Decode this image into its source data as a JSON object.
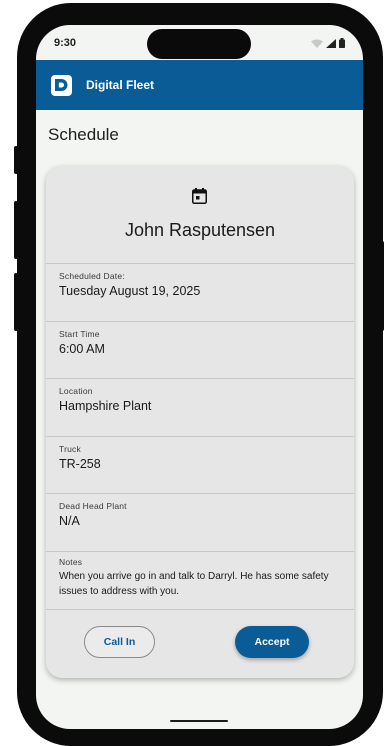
{
  "status_bar": {
    "time": "9:30",
    "icons": [
      "wifi-icon",
      "signal-icon",
      "battery-icon"
    ]
  },
  "app_bar": {
    "title": "Digital Fleet",
    "logo_letter": "D",
    "color": "#0a5c97"
  },
  "page": {
    "title": "Schedule"
  },
  "schedule": {
    "icon": "calendar-icon",
    "driver_name": "John Rasputensen",
    "fields": [
      {
        "label": "Scheduled Date:",
        "value": "Tuesday August 19, 2025"
      },
      {
        "label": "Start Time",
        "value": "6:00 AM"
      },
      {
        "label": "Location",
        "value": "Hampshire Plant"
      },
      {
        "label": "Truck",
        "value": "TR-258"
      },
      {
        "label": "Dead Head Plant",
        "value": "N/A"
      },
      {
        "label": "Notes",
        "value": "When you arrive go in and talk to Darryl. He has some safety issues to address with you."
      }
    ],
    "actions": {
      "call_in": "Call In",
      "accept": "Accept"
    }
  }
}
